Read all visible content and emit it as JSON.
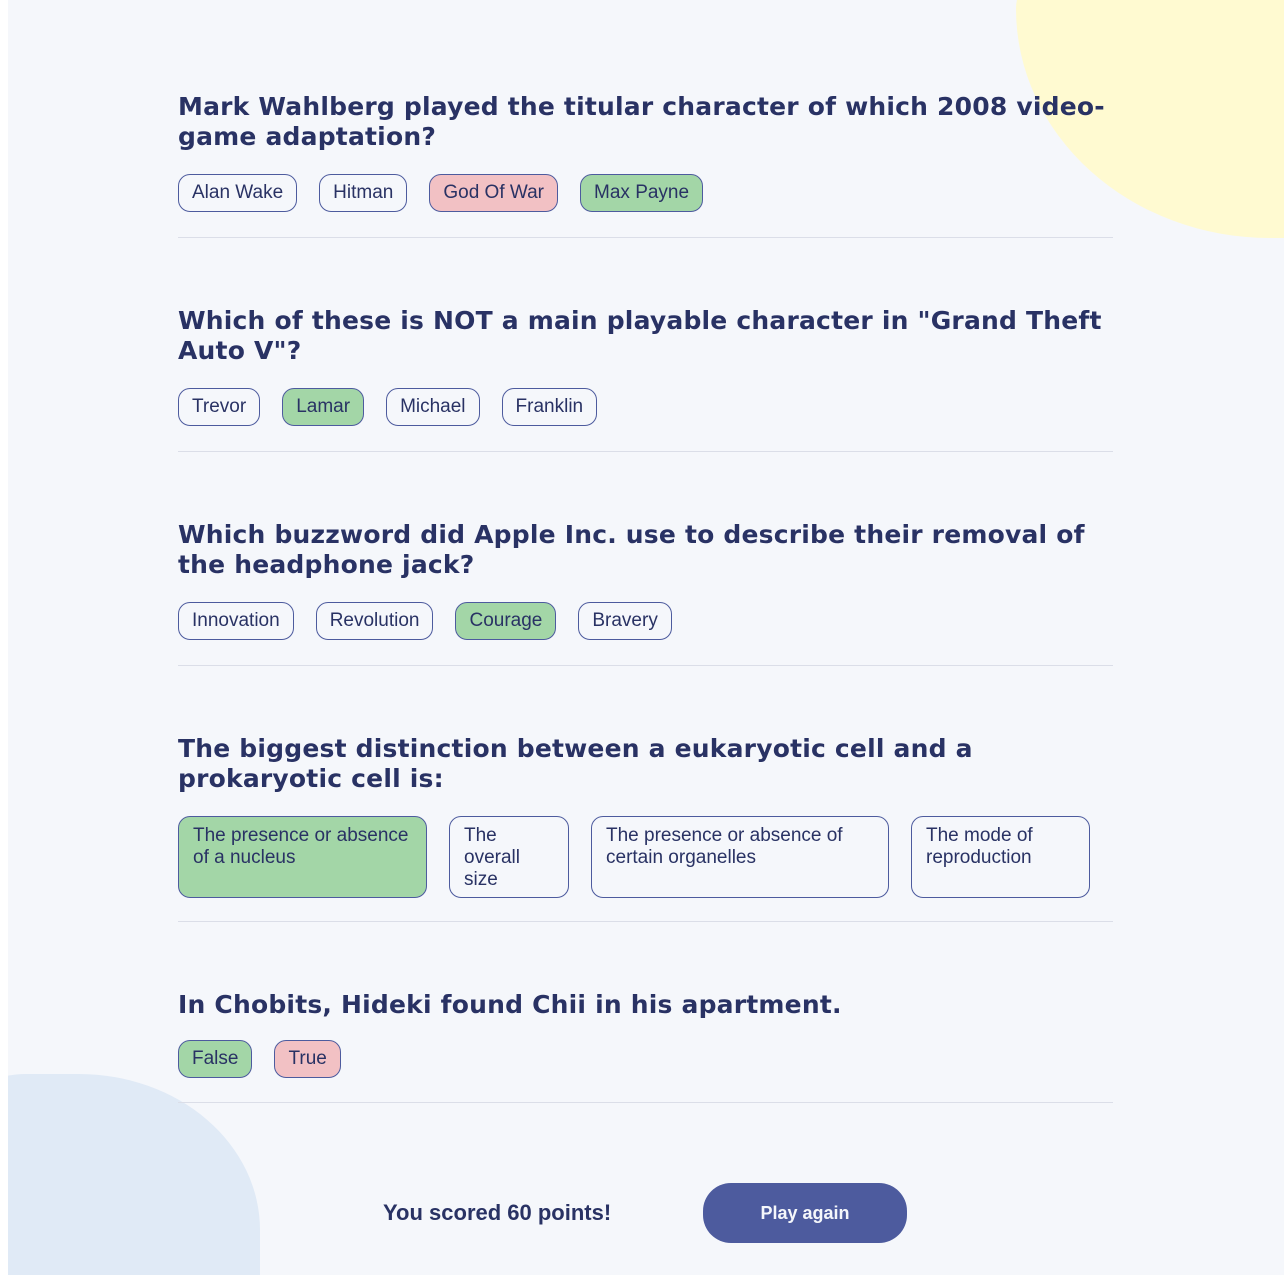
{
  "questions": [
    {
      "text": "Mark Wahlberg played the titular character of which 2008 video-game adaptation?",
      "answers": [
        {
          "label": "Alan Wake",
          "state": "neutral"
        },
        {
          "label": "Hitman",
          "state": "neutral"
        },
        {
          "label": "God Of War",
          "state": "wrong"
        },
        {
          "label": "Max Payne",
          "state": "correct"
        }
      ]
    },
    {
      "text": "Which of these is NOT a main playable character in \"Grand Theft Auto V\"?",
      "answers": [
        {
          "label": "Trevor",
          "state": "neutral"
        },
        {
          "label": "Lamar",
          "state": "correct"
        },
        {
          "label": "Michael",
          "state": "neutral"
        },
        {
          "label": "Franklin",
          "state": "neutral"
        }
      ]
    },
    {
      "text": "Which buzzword did Apple Inc. use to describe their removal of the headphone jack?",
      "answers": [
        {
          "label": "Innovation",
          "state": "neutral"
        },
        {
          "label": "Revolution",
          "state": "neutral"
        },
        {
          "label": "Courage",
          "state": "correct"
        },
        {
          "label": "Bravery",
          "state": "neutral"
        }
      ]
    },
    {
      "text": "The biggest distinction between a eukaryotic cell and a prokaryotic cell is:",
      "answers": [
        {
          "label": "The presence or absence of a nucleus",
          "state": "correct"
        },
        {
          "label": "The overall size",
          "state": "neutral"
        },
        {
          "label": "The presence or absence of certain organelles",
          "state": "neutral"
        },
        {
          "label": "The mode of reproduction",
          "state": "neutral"
        }
      ]
    },
    {
      "text": "In Chobits, Hideki found Chii in his apartment.",
      "answers": [
        {
          "label": "False",
          "state": "correct"
        },
        {
          "label": "True",
          "state": "wrong"
        }
      ]
    }
  ],
  "footer": {
    "score_text": "You scored 60 points!",
    "play_again_label": "Play again"
  },
  "colors": {
    "background": "#f5f7fb",
    "text": "#293264",
    "correct": "#a3d6a7",
    "wrong": "#f2c1c4",
    "button": "#4d5b9e",
    "blob_yellow": "#fffad1",
    "blob_blue": "#e0eaf6"
  }
}
